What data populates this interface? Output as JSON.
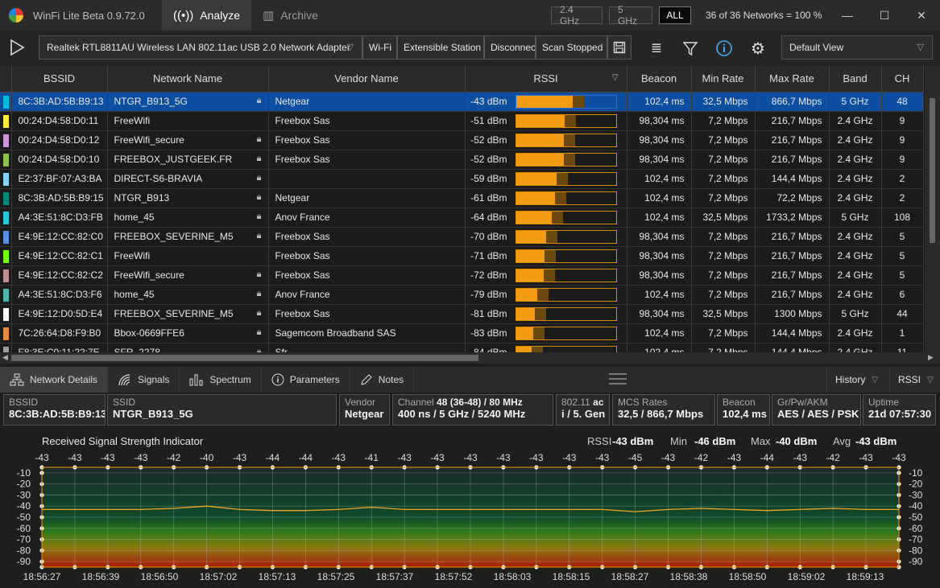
{
  "titlebar": {
    "title": "WinFi Lite Beta 0.9.72.0",
    "tabs": [
      {
        "label": "Analyze",
        "icon": "wifi-icon"
      },
      {
        "label": "Archive",
        "icon": "archive-icon"
      }
    ],
    "filters": [
      "2.4 GHz",
      "5 GHz",
      "ALL"
    ],
    "selected_filter": "ALL",
    "network_count": "36 of 36 Networks = 100 %"
  },
  "toolbar": {
    "adapter": "Realtek RTL8811AU Wireless LAN 802.11ac USB 2.0 Network Adapter",
    "info": [
      "Wi-Fi",
      "Extensible Station",
      "Disconnected",
      "Scan Stopped"
    ],
    "view": "Default View"
  },
  "table": {
    "columns": [
      "BSSID",
      "Network Name",
      "Vendor Name",
      "RSSI",
      "Beacon",
      "Min Rate",
      "Max Rate",
      "Band",
      "CH"
    ],
    "rows": [
      {
        "color": "#00bcd4",
        "bssid": "8C:3B:AD:5B:B9:13",
        "name": "NTGR_B913_5G",
        "lock": true,
        "vendor": "Netgear",
        "rssi": "-43 dBm",
        "rssi_val": -43,
        "beacon": "102,4 ms",
        "min": "32,5 Mbps",
        "max": "866,7 Mbps",
        "band": "5 GHz",
        "ch": "48"
      },
      {
        "color": "#ffeb3b",
        "bssid": "00:24:D4:58:D0:11",
        "name": "FreeWifi",
        "lock": false,
        "vendor": "Freebox Sas",
        "rssi": "-51 dBm",
        "rssi_val": -51,
        "beacon": "98,304 ms",
        "min": "7,2 Mbps",
        "max": "216,7 Mbps",
        "band": "2.4 GHz",
        "ch": "9"
      },
      {
        "color": "#ce93d8",
        "bssid": "00:24:D4:58:D0:12",
        "name": "FreeWifi_secure",
        "lock": true,
        "vendor": "Freebox Sas",
        "rssi": "-52 dBm",
        "rssi_val": -52,
        "beacon": "98,304 ms",
        "min": "7,2 Mbps",
        "max": "216,7 Mbps",
        "band": "2.4 GHz",
        "ch": "9"
      },
      {
        "color": "#8bc34a",
        "bssid": "00:24:D4:58:D0:10",
        "name": "FREEBOX_JUSTGEEK.FR",
        "lock": true,
        "vendor": "Freebox Sas",
        "rssi": "-52 dBm",
        "rssi_val": -52,
        "beacon": "98,304 ms",
        "min": "7,2 Mbps",
        "max": "216,7 Mbps",
        "band": "2.4 GHz",
        "ch": "9"
      },
      {
        "color": "#81d4fa",
        "bssid": "E2:37:BF:07:A3:BA",
        "name": "DIRECT-S6-BRAVIA",
        "lock": true,
        "vendor": "",
        "rssi": "-59 dBm",
        "rssi_val": -59,
        "beacon": "102,4 ms",
        "min": "7,2 Mbps",
        "max": "144,4 Mbps",
        "band": "2.4 GHz",
        "ch": "2"
      },
      {
        "color": "#00897b",
        "bssid": "8C:3B:AD:5B:B9:15",
        "name": "NTGR_B913",
        "lock": true,
        "vendor": "Netgear",
        "rssi": "-61 dBm",
        "rssi_val": -61,
        "beacon": "102,4 ms",
        "min": "7,2 Mbps",
        "max": "72,2 Mbps",
        "band": "2.4 GHz",
        "ch": "2"
      },
      {
        "color": "#26c6da",
        "bssid": "A4:3E:51:8C:D3:FB",
        "name": "home_45",
        "lock": true,
        "vendor": "Anov France",
        "rssi": "-64 dBm",
        "rssi_val": -64,
        "beacon": "102,4 ms",
        "min": "32,5 Mbps",
        "max": "1733,2 Mbps",
        "band": "5 GHz",
        "ch": "108"
      },
      {
        "color": "#5c8de0",
        "bssid": "E4:9E:12:CC:82:C0",
        "name": "FREEBOX_SEVERINE_M5",
        "lock": true,
        "vendor": "Freebox Sas",
        "rssi": "-70 dBm",
        "rssi_val": -70,
        "beacon": "98,304 ms",
        "min": "7,2 Mbps",
        "max": "216,7 Mbps",
        "band": "2.4 GHz",
        "ch": "5"
      },
      {
        "color": "#76ff03",
        "bssid": "E4:9E:12:CC:82:C1",
        "name": "FreeWifi",
        "lock": false,
        "vendor": "Freebox Sas",
        "rssi": "-71 dBm",
        "rssi_val": -71,
        "beacon": "98,304 ms",
        "min": "7,2 Mbps",
        "max": "216,7 Mbps",
        "band": "2.4 GHz",
        "ch": "5"
      },
      {
        "color": "#bc8f8f",
        "bssid": "E4:9E:12:CC:82:C2",
        "name": "FreeWifi_secure",
        "lock": true,
        "vendor": "Freebox Sas",
        "rssi": "-72 dBm",
        "rssi_val": -72,
        "beacon": "98,304 ms",
        "min": "7,2 Mbps",
        "max": "216,7 Mbps",
        "band": "2.4 GHz",
        "ch": "5"
      },
      {
        "color": "#4db6ac",
        "bssid": "A4:3E:51:8C:D3:F6",
        "name": "home_45",
        "lock": true,
        "vendor": "Anov France",
        "rssi": "-79 dBm",
        "rssi_val": -79,
        "beacon": "102,4 ms",
        "min": "7,2 Mbps",
        "max": "216,7 Mbps",
        "band": "2.4 GHz",
        "ch": "6"
      },
      {
        "color": "#ffffff",
        "bssid": "E4:9E:12:D0:5D:E4",
        "name": "FREEBOX_SEVERINE_M5",
        "lock": true,
        "vendor": "Freebox Sas",
        "rssi": "-81 dBm",
        "rssi_val": -81,
        "beacon": "98,304 ms",
        "min": "32,5 Mbps",
        "max": "1300 Mbps",
        "band": "5 GHz",
        "ch": "44"
      },
      {
        "color": "#e08a3c",
        "bssid": "7C:26:64:D8:F9:B0",
        "name": "Bbox-0669FFE6",
        "lock": true,
        "vendor": "Sagemcom Broadband SAS",
        "rssi": "-83 dBm",
        "rssi_val": -83,
        "beacon": "102,4 ms",
        "min": "7,2 Mbps",
        "max": "144,4 Mbps",
        "band": "2.4 GHz",
        "ch": "1"
      },
      {
        "color": "#9e9e9e",
        "bssid": "F8:3E:C0:11:22:7E",
        "name": "SFR_2278",
        "lock": true,
        "vendor": "Sfr",
        "rssi": "-84 dBm",
        "rssi_val": -84,
        "beacon": "102,4 ms",
        "min": "7,2 Mbps",
        "max": "144,4 Mbps",
        "band": "2.4 GHz",
        "ch": "11"
      }
    ]
  },
  "bottom_tabs": {
    "tabs": [
      {
        "label": "Network Details",
        "icon": "network-icon"
      },
      {
        "label": "Signals",
        "icon": "signal-icon"
      },
      {
        "label": "Spectrum",
        "icon": "spectrum-icon"
      },
      {
        "label": "Parameters",
        "icon": "info-icon"
      },
      {
        "label": "Notes",
        "icon": "pencil-icon"
      }
    ],
    "history": "History",
    "metric": "RSSI"
  },
  "details": {
    "bssid_label": "BSSID",
    "bssid": "8C:3B:AD:5B:B9:13",
    "ssid_label": "SSID",
    "ssid": "NTGR_B913_5G",
    "vendor_label": "Vendor",
    "vendor": "Netgear",
    "channel_label": "Channel",
    "channel": "48 (36-48)  /  80 MHz",
    "channel_sub": "400 ns / 5 GHz / 5240 MHz",
    "std_label": "802.11",
    "std": "ac",
    "std_sub": "i / 5. Gen",
    "mcs_label": "MCS Rates",
    "mcs": "32,5 / 866,7 Mbps",
    "beacon_label": "Beacon",
    "beacon": "102,4 ms",
    "sec_label": "Gr/Pw/AKM",
    "sec": "AES / AES / PSK",
    "uptime_label": "Uptime",
    "uptime": "21d 07:57:30"
  },
  "chart_data": {
    "type": "line",
    "title": "Received Signal Strength Indicator",
    "stats": {
      "rssi_label": "RSSI",
      "rssi": "-43 dBm",
      "min_label": "Min",
      "min": "-46 dBm",
      "max_label": "Max",
      "max": "-40 dBm",
      "avg_label": "Avg",
      "avg": "-43 dBm"
    },
    "top_labels": [
      "-43",
      "-43",
      "-43",
      "-43",
      "-42",
      "-40",
      "-43",
      "-44",
      "-44",
      "-43",
      "-41",
      "-43",
      "-43",
      "-43",
      "-43",
      "-43",
      "-43",
      "-43",
      "-45",
      "-43",
      "-42",
      "-43",
      "-44",
      "-43",
      "-42",
      "-43",
      "-43"
    ],
    "y_ticks": [
      -10,
      -20,
      -30,
      -40,
      -50,
      -60,
      -70,
      -80,
      -90
    ],
    "ylim": [
      -95,
      -5
    ],
    "x_ticks": [
      "18:56:27",
      "18:56:39",
      "18:56:50",
      "18:57:02",
      "18:57:13",
      "18:57:25",
      "18:57:37",
      "18:57:52",
      "18:58:03",
      "18:58:15",
      "18:58:27",
      "18:58:38",
      "18:58:50",
      "18:59:02",
      "18:59:13"
    ],
    "values": [
      -43,
      -43,
      -43,
      -43,
      -42,
      -40,
      -43,
      -44,
      -44,
      -43,
      -41,
      -43,
      -43,
      -43,
      -43,
      -43,
      -43,
      -43,
      -45,
      -43,
      -42,
      -43,
      -44,
      -43,
      -42,
      -43,
      -43
    ],
    "colors": {
      "line": "#f5a623",
      "frame": "#e08a00"
    }
  }
}
